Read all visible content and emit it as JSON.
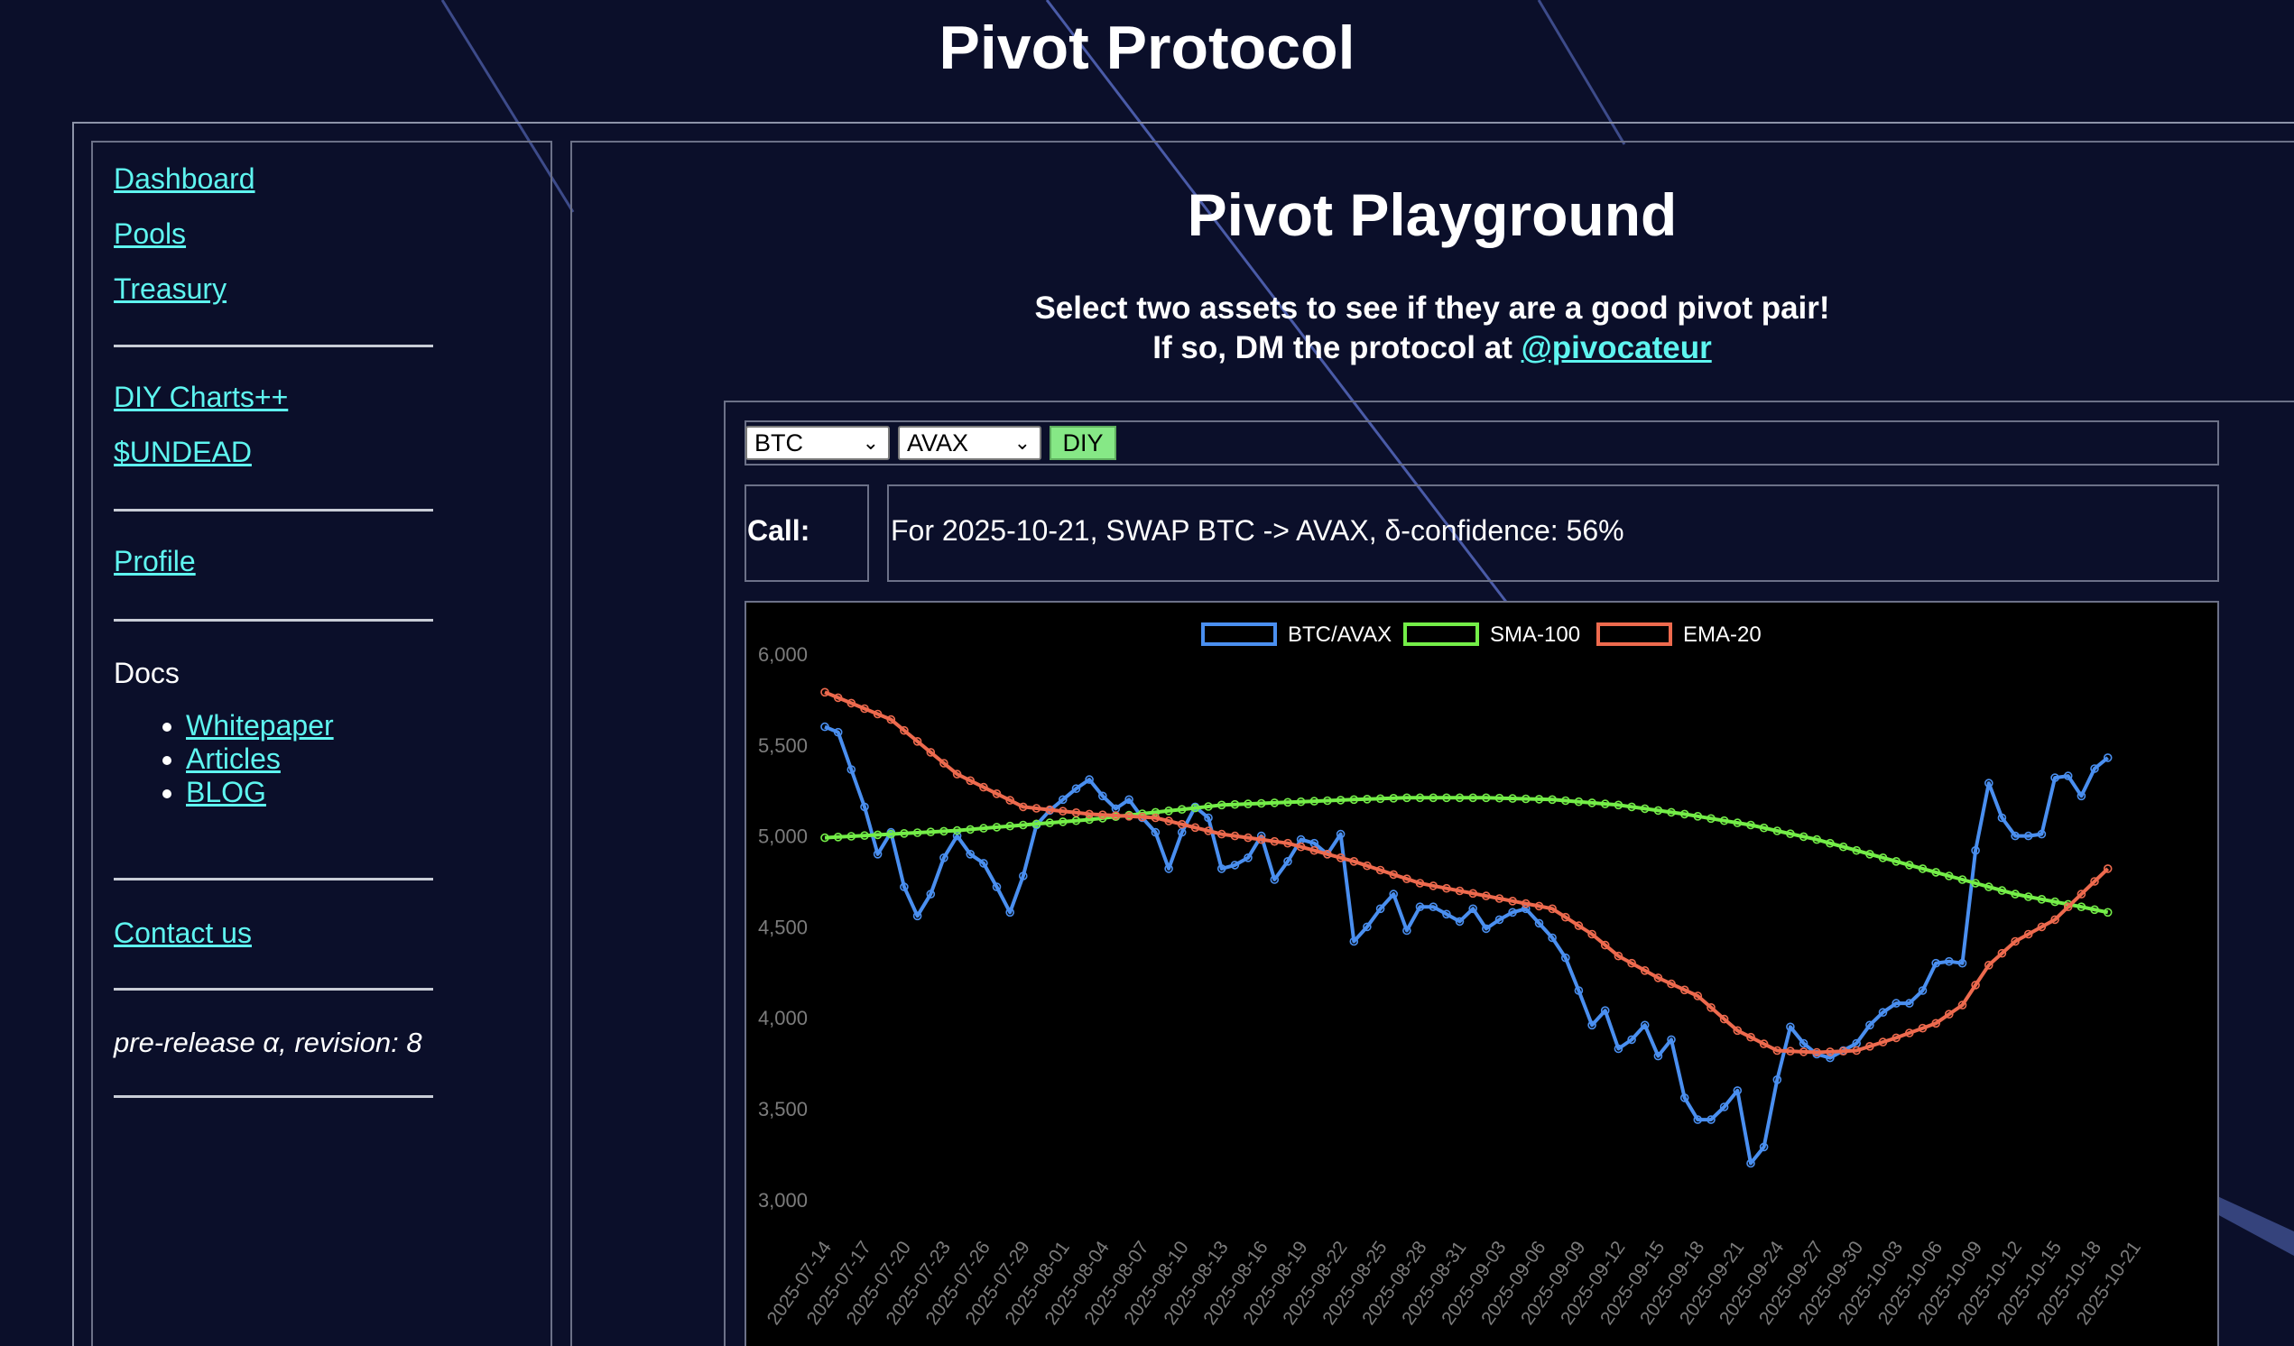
{
  "site_title": "Pivot Protocol",
  "sidebar": {
    "links_top": [
      "Dashboard",
      "Pools",
      "Treasury"
    ],
    "links_mid": [
      "DIY Charts++",
      "$UNDEAD"
    ],
    "profile": "Profile",
    "docs": {
      "label": "Docs",
      "items": [
        "Whitepaper",
        "Articles",
        "BLOG"
      ]
    },
    "contact": "Contact us",
    "version": "pre-release α, revision: 8"
  },
  "main": {
    "title": "Pivot Playground",
    "intro_line1": "Select two assets to see if they are a good pivot pair!",
    "intro_line2_prefix": "If so, DM the protocol at ",
    "intro_handle": "@pivocateur",
    "controls": {
      "asset_a": "BTC",
      "asset_b": "AVAX",
      "button": "DIY"
    },
    "call": {
      "label": "Call:",
      "value": "For 2025-10-21, SWAP BTC -> AVAX, δ-confidence: 56%"
    }
  },
  "colors": {
    "background": "#0b0f2a",
    "link": "#5ef5f0",
    "series_pair": "#4a8ff0",
    "series_sma": "#74ee48",
    "series_ema": "#ee6a4e"
  },
  "chart_data": {
    "type": "line",
    "title": "",
    "xlabel": "",
    "ylabel": "",
    "ylim": [
      2900,
      6000
    ],
    "yticks": [
      "6,000",
      "5,500",
      "5,000",
      "4,500",
      "4,000",
      "3,500",
      "3,000"
    ],
    "xticks": [
      "2025-07-14",
      "2025-07-17",
      "2025-07-20",
      "2025-07-23",
      "2025-07-26",
      "2025-07-29",
      "2025-08-01",
      "2025-08-04",
      "2025-08-07",
      "2025-08-10",
      "2025-08-13",
      "2025-08-16",
      "2025-08-19",
      "2025-08-22",
      "2025-08-25",
      "2025-08-28",
      "2025-08-31",
      "2025-09-03",
      "2025-09-06",
      "2025-09-09",
      "2025-09-12",
      "2025-09-15",
      "2025-09-18",
      "2025-09-21",
      "2025-09-24",
      "2025-09-27",
      "2025-09-30",
      "2025-10-03",
      "2025-10-06",
      "2025-10-09",
      "2025-10-12",
      "2025-10-15",
      "2025-10-18",
      "2025-10-21"
    ],
    "legend_position": "top-center",
    "series": [
      {
        "name": "BTC/AVAX",
        "points": [
          [
            0,
            5600
          ],
          [
            1,
            5570
          ],
          [
            3,
            5160
          ],
          [
            4,
            4900
          ],
          [
            5,
            5020
          ],
          [
            6,
            4720
          ],
          [
            7,
            4560
          ],
          [
            8,
            4680
          ],
          [
            9,
            4880
          ],
          [
            10,
            5000
          ],
          [
            11,
            4900
          ],
          [
            12,
            4850
          ],
          [
            13,
            4720
          ],
          [
            14,
            4580
          ],
          [
            15,
            4780
          ],
          [
            16,
            5060
          ],
          [
            17,
            5140
          ],
          [
            18,
            5200
          ],
          [
            19,
            5260
          ],
          [
            20,
            5310
          ],
          [
            21,
            5220
          ],
          [
            22,
            5150
          ],
          [
            23,
            5200
          ],
          [
            24,
            5100
          ],
          [
            25,
            5020
          ],
          [
            26,
            4820
          ],
          [
            27,
            5020
          ],
          [
            28,
            5160
          ],
          [
            29,
            5100
          ],
          [
            30,
            4820
          ],
          [
            31,
            4840
          ],
          [
            32,
            4880
          ],
          [
            33,
            5000
          ],
          [
            34,
            4760
          ],
          [
            35,
            4860
          ],
          [
            36,
            4980
          ],
          [
            37,
            4960
          ],
          [
            38,
            4900
          ],
          [
            39,
            5010
          ],
          [
            40,
            4420
          ],
          [
            41,
            4500
          ],
          [
            42,
            4600
          ],
          [
            43,
            4680
          ],
          [
            44,
            4480
          ],
          [
            45,
            4610
          ],
          [
            46,
            4610
          ],
          [
            47,
            4570
          ],
          [
            48,
            4530
          ],
          [
            49,
            4600
          ],
          [
            50,
            4490
          ],
          [
            51,
            4540
          ],
          [
            52,
            4580
          ],
          [
            53,
            4600
          ],
          [
            54,
            4520
          ],
          [
            55,
            4440
          ],
          [
            56,
            4330
          ],
          [
            57,
            4150
          ],
          [
            58,
            3960
          ],
          [
            59,
            4040
          ],
          [
            60,
            3830
          ],
          [
            61,
            3880
          ],
          [
            62,
            3960
          ],
          [
            63,
            3790
          ],
          [
            64,
            3880
          ],
          [
            65,
            3560
          ],
          [
            66,
            3440
          ],
          [
            67,
            3440
          ],
          [
            68,
            3510
          ],
          [
            69,
            3600
          ],
          [
            70,
            3200
          ],
          [
            71,
            3290
          ],
          [
            72,
            3660
          ],
          [
            73,
            3950
          ],
          [
            74,
            3860
          ],
          [
            75,
            3800
          ],
          [
            76,
            3780
          ],
          [
            77,
            3820
          ],
          [
            78,
            3860
          ],
          [
            79,
            3960
          ],
          [
            80,
            4030
          ],
          [
            81,
            4080
          ],
          [
            82,
            4080
          ],
          [
            83,
            4150
          ],
          [
            84,
            4300
          ],
          [
            85,
            4310
          ],
          [
            86,
            4300
          ],
          [
            87,
            4920
          ],
          [
            88,
            5290
          ],
          [
            89,
            5100
          ],
          [
            90,
            5000
          ],
          [
            91,
            5000
          ],
          [
            92,
            5010
          ],
          [
            93,
            5320
          ],
          [
            94,
            5330
          ],
          [
            95,
            5220
          ],
          [
            96,
            5370
          ],
          [
            97,
            5430
          ]
        ]
      },
      {
        "name": "SMA-100",
        "points": [
          [
            0,
            4990
          ],
          [
            10,
            5030
          ],
          [
            20,
            5090
          ],
          [
            30,
            5170
          ],
          [
            40,
            5200
          ],
          [
            44,
            5210
          ],
          [
            50,
            5210
          ],
          [
            55,
            5200
          ],
          [
            60,
            5170
          ],
          [
            65,
            5120
          ],
          [
            70,
            5060
          ],
          [
            75,
            4980
          ],
          [
            80,
            4880
          ],
          [
            85,
            4780
          ],
          [
            90,
            4680
          ],
          [
            95,
            4610
          ],
          [
            97,
            4580
          ]
        ]
      },
      {
        "name": "EMA-20",
        "points": [
          [
            0,
            5790
          ],
          [
            5,
            5640
          ],
          [
            10,
            5340
          ],
          [
            15,
            5160
          ],
          [
            20,
            5120
          ],
          [
            25,
            5100
          ],
          [
            30,
            5010
          ],
          [
            35,
            4960
          ],
          [
            40,
            4860
          ],
          [
            45,
            4740
          ],
          [
            50,
            4670
          ],
          [
            55,
            4600
          ],
          [
            58,
            4460
          ],
          [
            60,
            4340
          ],
          [
            63,
            4220
          ],
          [
            66,
            4120
          ],
          [
            69,
            3930
          ],
          [
            72,
            3820
          ],
          [
            75,
            3810
          ],
          [
            78,
            3820
          ],
          [
            81,
            3890
          ],
          [
            84,
            3970
          ],
          [
            86,
            4070
          ],
          [
            88,
            4290
          ],
          [
            90,
            4420
          ],
          [
            93,
            4540
          ],
          [
            95,
            4680
          ],
          [
            97,
            4820
          ]
        ]
      }
    ]
  }
}
